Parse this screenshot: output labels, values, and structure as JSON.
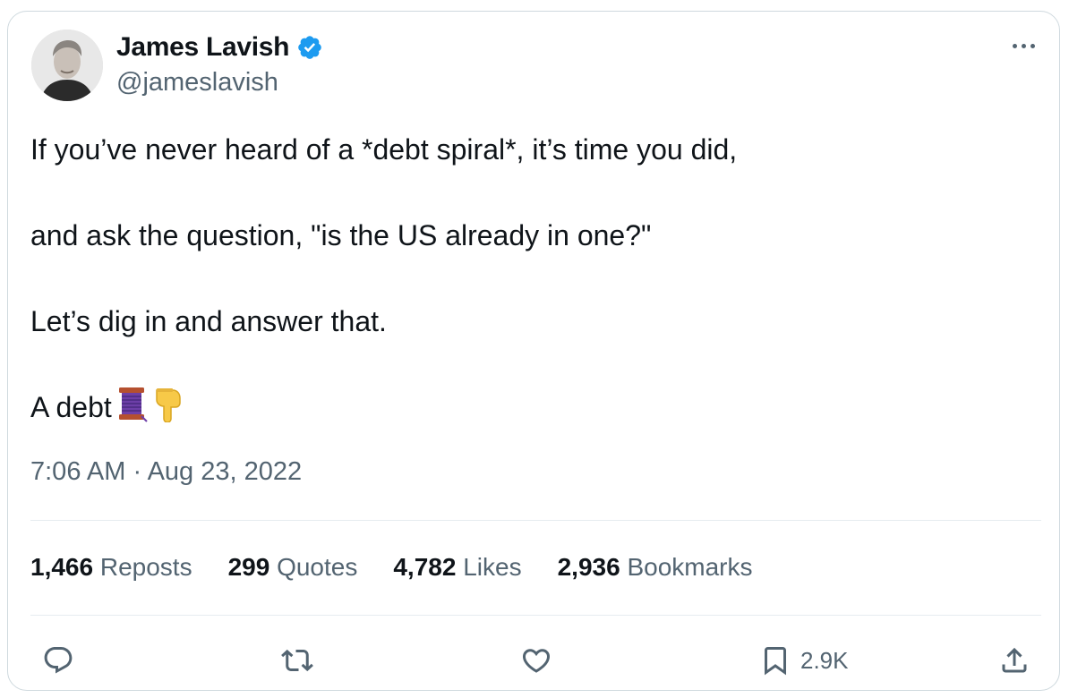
{
  "author": {
    "display_name": "James Lavish",
    "handle": "@jameslavish",
    "verified": true
  },
  "tweet": {
    "paragraphs": [
      "If you’ve never heard of a *debt spiral*, it’s time you did,",
      "and ask the question, \"is the US already in one?\"",
      "Let’s dig in and answer that.",
      "A debt"
    ],
    "trailing_emojis": [
      "spool-of-thread",
      "backhand-index-pointing-down"
    ],
    "timestamp": "7:06 AM · Aug 23, 2022"
  },
  "stats": {
    "reposts": {
      "count": "1,466",
      "label": "Reposts"
    },
    "quotes": {
      "count": "299",
      "label": "Quotes"
    },
    "likes": {
      "count": "4,782",
      "label": "Likes"
    },
    "bookmarks": {
      "count": "2,936",
      "label": "Bookmarks"
    }
  },
  "actions": {
    "bookmark_count": "2.9K",
    "icons": [
      "reply-icon",
      "repost-icon",
      "like-icon",
      "bookmark-icon",
      "share-icon"
    ]
  },
  "colors": {
    "text_primary": "#0f1419",
    "text_secondary": "#536471",
    "verified_blue": "#1d9bf0",
    "border": "#cfd9de"
  }
}
